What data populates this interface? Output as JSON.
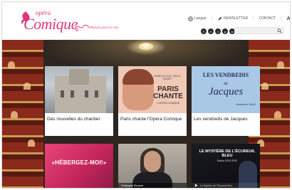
{
  "brand": {
    "opera": "opéra",
    "comique": "Comique",
    "tagline": "Maison pour la voix",
    "accent": "#e0357a"
  },
  "topnav": [
    {
      "icon": "globe-icon",
      "label": "Langue"
    },
    {
      "icon": "pencil-icon",
      "label": "NEWSLETTER"
    },
    {
      "icon": "",
      "label": "CONTACT"
    },
    {
      "icon": "font-size-icon",
      "label": "Aa"
    },
    {
      "icon": "user-icon",
      "label": ""
    }
  ],
  "socials": [
    "f",
    "t",
    "i",
    "y",
    "s"
  ],
  "search": {
    "placeholder": ""
  },
  "cards": [
    {
      "caption": "Des nouvelles du chantier"
    },
    {
      "caption": "Paris chante l'Opéra Comique",
      "thumb": {
        "small": "MARDI 10 JUIL. SALLE FAVART",
        "big": "PARIS CHANTE",
        "small2": "L'OPÉRA COMIQUE"
      }
    },
    {
      "caption": "Les vendredis de Jacques",
      "thumb": {
        "l1": "LES VENDREDIS",
        "l2": "de",
        "l3": "Jacques",
        "l4": "Vendredi à 12h30"
      }
    },
    {
      "thumb": {
        "text": "«HÉBERGEZ-MOI!»"
      }
    },
    {
      "thumb": {
        "cap": "Christophe Rousset"
      }
    },
    {
      "thumb": {
        "title": "LE MYSTÈRE DE L'ÉCUREUIL BLEU",
        "sub": "Saison 2019-2020",
        "cap": "Le Mystère de l'Écureuil bleu"
      }
    }
  ]
}
